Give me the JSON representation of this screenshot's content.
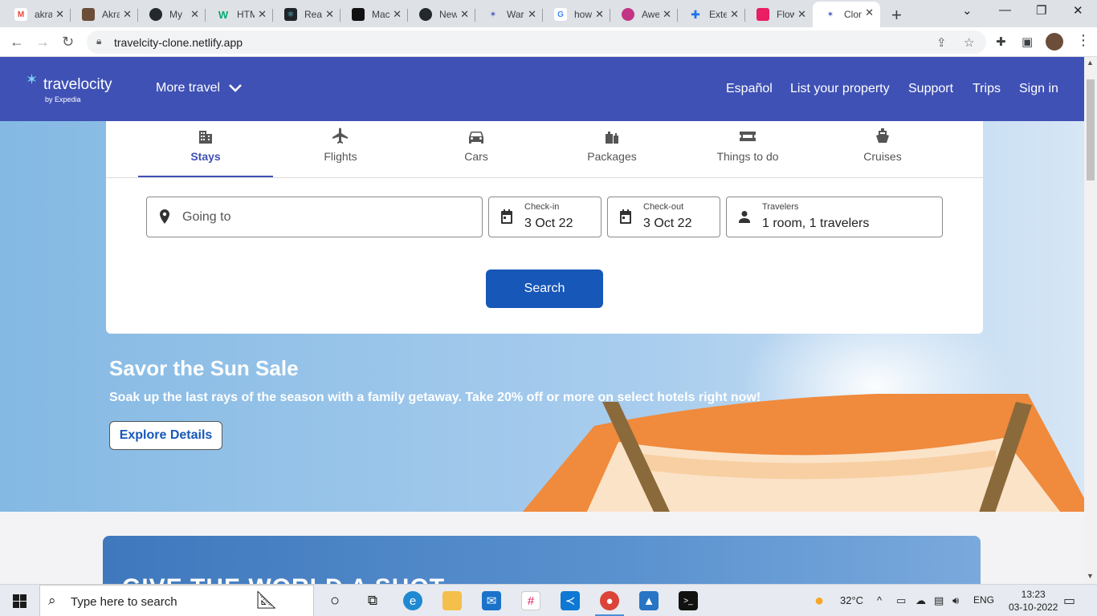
{
  "browser": {
    "tabs": [
      {
        "label": "akra",
        "icon": "gmail-icon",
        "color": "#ea4335"
      },
      {
        "label": "Akra",
        "icon": "profile-photo-icon",
        "color": "#6b4d3a"
      },
      {
        "label": "My",
        "icon": "github-icon",
        "color": "#24292e"
      },
      {
        "label": "HTML",
        "icon": "w3-icon",
        "color": "#04aa6d"
      },
      {
        "label": "React",
        "icon": "react-icon",
        "color": "#20232a"
      },
      {
        "label": "Mac",
        "icon": "app-icon",
        "color": "#111111"
      },
      {
        "label": "New",
        "icon": "github-icon",
        "color": "#24292e"
      },
      {
        "label": "War",
        "icon": "travelocity-icon",
        "color": "#3f51b5"
      },
      {
        "label": "how",
        "icon": "google-icon",
        "color": "#4285f4"
      },
      {
        "label": "Awe",
        "icon": "instagram-icon",
        "color": "#c13584"
      },
      {
        "label": "Exte",
        "icon": "puzzle-icon",
        "color": "#1a73e8"
      },
      {
        "label": "Flow",
        "icon": "flow-icon",
        "color": "#e91e63"
      },
      {
        "label": "Clon",
        "icon": "travelocity-icon",
        "color": "#3f51b5"
      }
    ],
    "new_tab": "+",
    "url": "travelcity-clone.netlify.app"
  },
  "site": {
    "logo_text": "travelocity",
    "logo_sub": "by Expedia",
    "more_travel": "More travel",
    "nav": [
      "Español",
      "List your property",
      "Support",
      "Trips",
      "Sign in"
    ]
  },
  "search": {
    "tabs": [
      {
        "label": "Stays",
        "icon": "building-icon",
        "active": true
      },
      {
        "label": "Flights",
        "icon": "plane-icon",
        "active": false
      },
      {
        "label": "Cars",
        "icon": "car-icon",
        "active": false
      },
      {
        "label": "Packages",
        "icon": "luggage-icon",
        "active": false
      },
      {
        "label": "Things to do",
        "icon": "ticket-icon",
        "active": false
      },
      {
        "label": "Cruises",
        "icon": "ship-icon",
        "active": false
      }
    ],
    "going_to_placeholder": "Going to",
    "checkin_label": "Check-in",
    "checkin_value": "3 Oct 22",
    "checkout_label": "Check-out",
    "checkout_value": "3 Oct 22",
    "travelers_label": "Travelers",
    "travelers_value": "1 room, 1 travelers",
    "search_button": "Search"
  },
  "promo": {
    "title": "Savor the Sun Sale",
    "subtitle": "Soak up the last rays of the season with a family getaway. Take 20% off or more on select hotels right now!",
    "button": "Explore Details",
    "banner_text": "GIVE THE WORLD A SHOT"
  },
  "taskbar": {
    "search_placeholder": "Type here to search",
    "weather": "32°C",
    "language": "ENG",
    "time": "13:23",
    "date": "03-10-2022"
  },
  "colors": {
    "header_blue": "#3f51b5",
    "button_blue": "#1657b8",
    "awning_orange": "#f08a3c"
  }
}
